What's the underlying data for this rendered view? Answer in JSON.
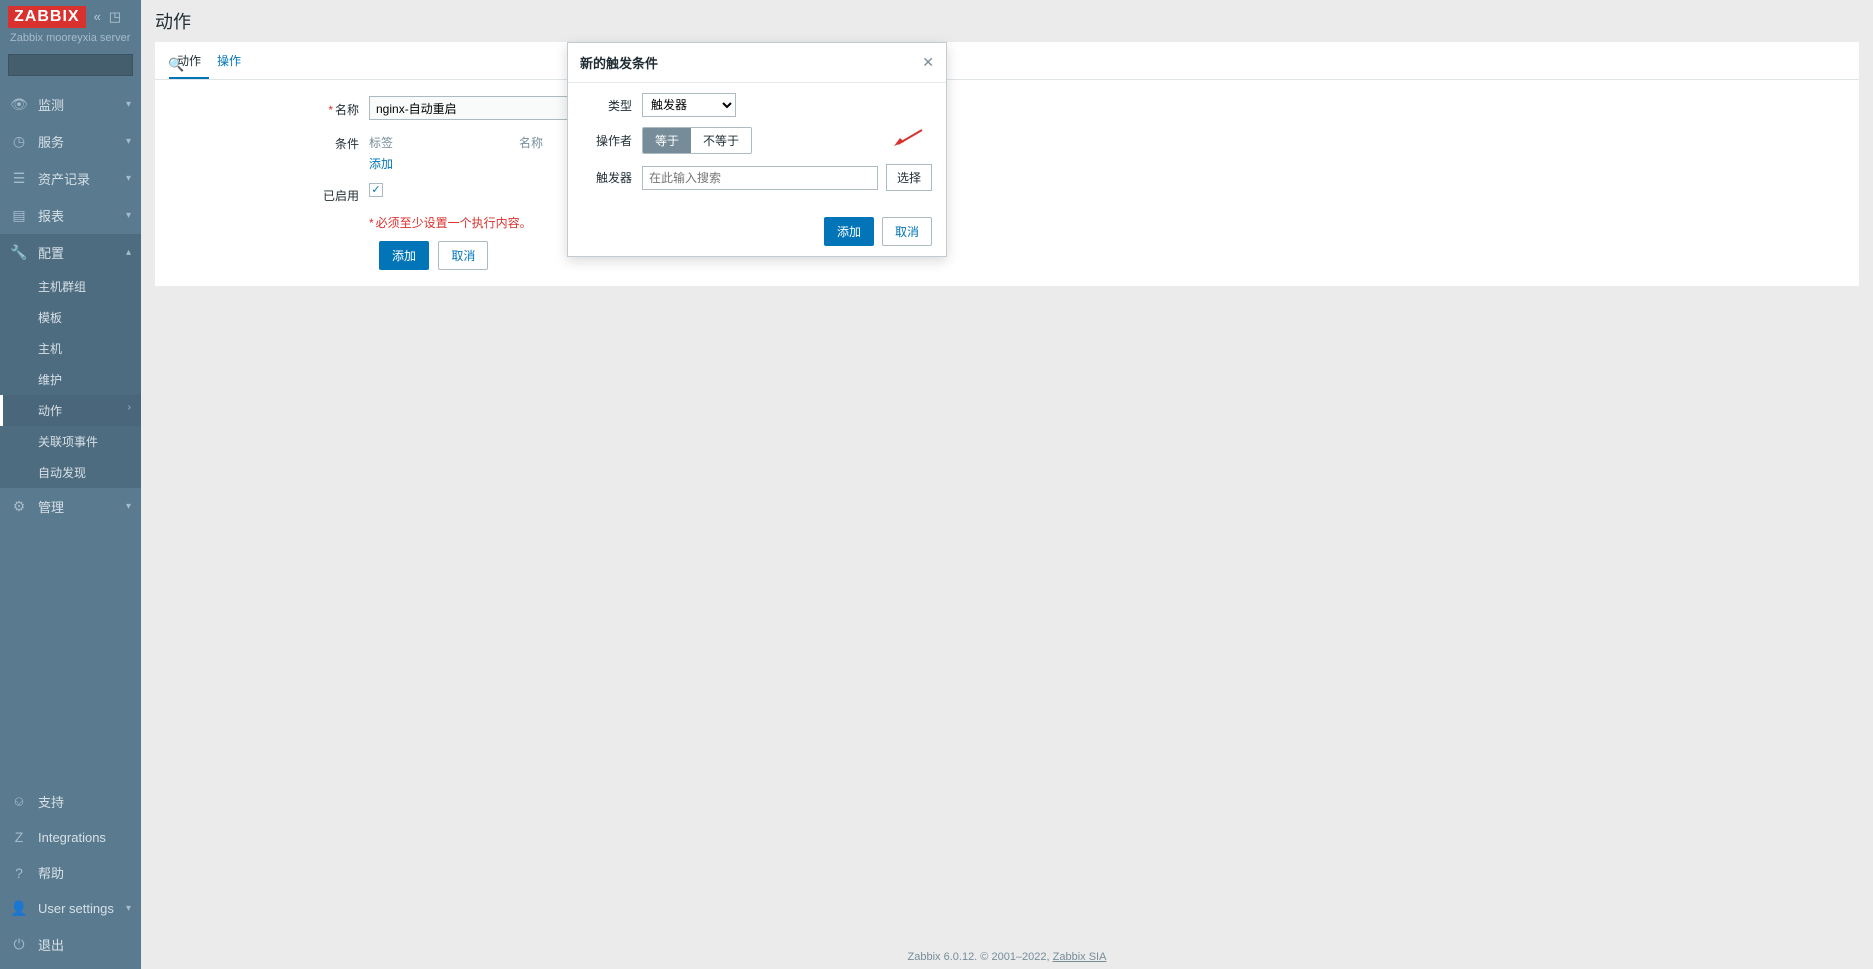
{
  "brand": "ZABBIX",
  "server_name": "Zabbix mooreyxia server",
  "sidebar": {
    "items": [
      {
        "icon": "eye",
        "label": "监测"
      },
      {
        "icon": "clock",
        "label": "服务"
      },
      {
        "icon": "list",
        "label": "资产记录"
      },
      {
        "icon": "chart",
        "label": "报表"
      },
      {
        "icon": "wrench",
        "label": "配置"
      },
      {
        "icon": "gear",
        "label": "管理"
      }
    ],
    "config_sub": [
      {
        "label": "主机群组"
      },
      {
        "label": "模板"
      },
      {
        "label": "主机"
      },
      {
        "label": "维护"
      },
      {
        "label": "动作",
        "active": true,
        "caret": true
      },
      {
        "label": "关联项事件"
      },
      {
        "label": "自动发现"
      }
    ],
    "footer": [
      {
        "icon": "support",
        "label": "支持"
      },
      {
        "icon": "z",
        "label": "Integrations"
      },
      {
        "icon": "help",
        "label": "帮助"
      },
      {
        "icon": "user",
        "label": "User settings",
        "caret": true
      },
      {
        "icon": "power",
        "label": "退出"
      }
    ]
  },
  "page": {
    "title": "动作",
    "tabs": [
      {
        "label": "动作",
        "active": true
      },
      {
        "label": "操作"
      }
    ],
    "form": {
      "name_label": "名称",
      "name_value": "nginx-自动重启",
      "cond_label": "条件",
      "cond_col1": "标签",
      "cond_col2": "名称",
      "cond_add": "添加",
      "enabled_label": "已启用",
      "error": "必须至少设置一个执行内容。",
      "add_btn": "添加",
      "cancel_btn": "取消"
    }
  },
  "modal": {
    "title": "新的触发条件",
    "type_label": "类型",
    "type_value": "触发器",
    "op_label": "操作者",
    "op_eq": "等于",
    "op_neq": "不等于",
    "trigger_label": "触发器",
    "trigger_placeholder": "在此输入搜索",
    "select_btn": "选择",
    "add_btn": "添加",
    "cancel_btn": "取消"
  },
  "footer": {
    "text": "Zabbix 6.0.12. © 2001–2022, ",
    "link": "Zabbix SIA"
  }
}
